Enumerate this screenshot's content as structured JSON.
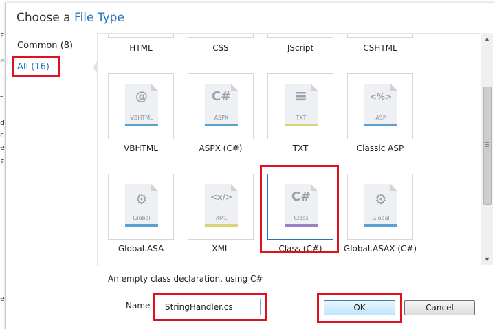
{
  "dialog": {
    "title_prefix": "Choose a",
    "title_highlight": "File Type"
  },
  "sidebar": {
    "items": [
      {
        "label": "Common",
        "count": "(8)",
        "active": false
      },
      {
        "label": "All",
        "count": "(16)",
        "active": true
      }
    ]
  },
  "top_row_labels": [
    "HTML",
    "CSS",
    "JScript",
    "CSHTML"
  ],
  "tiles": [
    {
      "label": "VBHTML",
      "glyph": "@",
      "sub": "VBHTML",
      "band": "#5aa0d0"
    },
    {
      "label": "ASPX (C#)",
      "glyph": "C#",
      "sub": "ASPX",
      "band": "#5aa0d0"
    },
    {
      "label": "TXT",
      "glyph": "≡",
      "sub": "TXT",
      "band": "#d8d47a"
    },
    {
      "label": "Classic ASP",
      "glyph": "<%>",
      "sub": "ASP",
      "band": "#5aa0d0"
    },
    {
      "label": "Global.ASA",
      "glyph": "⚙",
      "sub": "Global",
      "band": "#5aa0d0"
    },
    {
      "label": "XML",
      "glyph": "<x/>",
      "sub": "XML",
      "band": "#d8d47a"
    },
    {
      "label": "Class (C#)",
      "glyph": "C#",
      "sub": "Class",
      "band": "#9c7fc4"
    },
    {
      "label": "Global.ASAX (C#)",
      "glyph": "⚙",
      "sub": "Global",
      "band": "#5aa0d0"
    }
  ],
  "description": "An empty class declaration, using C#",
  "name_field": {
    "label": "Name",
    "value": "StringHandler.cs"
  },
  "buttons": {
    "ok": "OK",
    "cancel": "Cancel"
  },
  "colors": {
    "accent": "#2a74b8",
    "highlight_box": "#e0101f"
  }
}
